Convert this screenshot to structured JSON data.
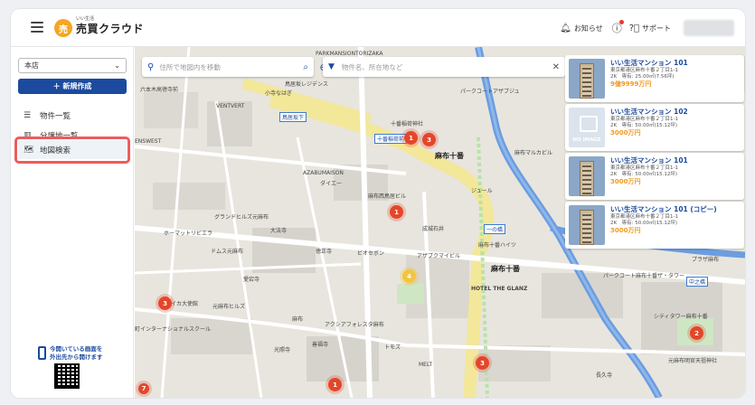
{
  "header": {
    "logo_mark": "売",
    "logo_sub": "いい生活",
    "logo_title": "売買クラウド",
    "notifications": "お知らせ",
    "support": "サポート"
  },
  "sidebar": {
    "store": "本店",
    "new_button": "＋ 新規作成",
    "items": [
      {
        "label": "物件一覧",
        "icon": "list-icon"
      },
      {
        "label": "分譲地一覧",
        "icon": "building-icon"
      },
      {
        "label": "地図検索",
        "icon": "map-icon"
      }
    ],
    "promo_line1": "今開いている画面を",
    "promo_line2": "外出先から開けます"
  },
  "map": {
    "search_placeholder": "住所で地図内を移動",
    "filter_placeholder": "物件名、所在地など",
    "labels": {
      "l1": "PARKMANSION",
      "l2": "鳥居坂下",
      "l3": "PARKMANSIONTORIZAKA",
      "l4": "六本木高徳寺前",
      "l5": "鳥居坂レジデンス",
      "l6": "小寺なはぎ",
      "l7": "VENTVERT",
      "l8": "十番稲荷神社",
      "l9": "十番稲荷前",
      "l10": "麻布十番",
      "l11": "麻布マルカビル",
      "l12": "ENSWEST",
      "l13": "AZABUMAISON",
      "l14": "ダイエー",
      "l15": "麻布西鳥居ビル",
      "l16": "グランドヒルズ元麻布",
      "l17": "大法寺",
      "l18": "成城石井",
      "l19": "ホーマットリビエラ",
      "l20": "ドムス元麻布",
      "l21": "徳正寺",
      "l22": "ビオセボン",
      "l23": "アザブクマイビル",
      "l24": "麻布十番ハイツ",
      "l25": "麻布十番",
      "l26": "HOTEL THE GLANZ",
      "l27": "パークコート麻布十番ザ・タワー",
      "l28": "元麻布ヒルズ",
      "l29": "イカ大使館",
      "l30": "町インターナショナルスクール",
      "l31": "アクシアフォレスタ麻布",
      "l32": "麻布",
      "l33": "シティタワー麻布十番",
      "l34": "トモズ",
      "l35": "MELT",
      "l36": "元麻布明官天祖神社",
      "l37": "プラザ麻布",
      "l38": "長久寺",
      "l39": "光照寺",
      "l40": "善福寺",
      "l41": "一の橋",
      "l42": "ジュール",
      "l43": "パークコートアザブジュ",
      "l44": "中之橋",
      "l45": "愛宕寺"
    },
    "clusters": [
      "1",
      "3",
      "1",
      "4",
      "3",
      "2",
      "3",
      "1",
      "7"
    ]
  },
  "cards": [
    {
      "title": "いい生活マンション 101",
      "address": "東京都港区麻布十番２丁目1-1",
      "spec": "2K　専有: 25.00㎡(7.56坪)",
      "price": "9億9999万円",
      "image": "building"
    },
    {
      "title": "いい生活マンション 102",
      "address": "東京都港区麻布十番２丁目1-1",
      "spec": "2K　専有: 50.00㎡(15.12坪)",
      "price": "3000万円",
      "image": "none",
      "noimage_label": "NO IMAGE"
    },
    {
      "title": "いい生活マンション 101",
      "address": "東京都港区麻布十番２丁目1-1",
      "spec": "2K　専有: 50.00㎡(15.12坪)",
      "price": "3000万円",
      "image": "building"
    },
    {
      "title": "いい生活マンション 101 (コピー)",
      "address": "東京都港区麻布十番２丁目1-1",
      "spec": "2K　専有: 50.00㎡(15.12坪)",
      "price": "3000万円",
      "image": "building"
    }
  ]
}
